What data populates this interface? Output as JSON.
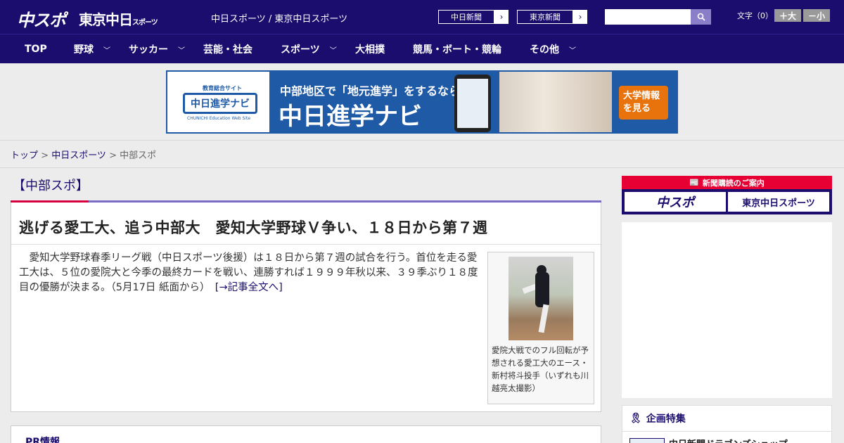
{
  "header": {
    "logo_chuspo": "中スポ",
    "logo_tokyo": "東京中日",
    "logo_tokyo_small": "スポーツ",
    "site_links": "中日スポーツ / 東京中日スポーツ",
    "btn_chunichi": "中日新聞",
    "btn_tokyo": "東京新聞",
    "search_placeholder": "",
    "moji_label": "文字（0）",
    "size_up": "＋大",
    "size_down": "－小"
  },
  "nav": {
    "items": [
      {
        "label": "TOP",
        "has_menu": false
      },
      {
        "label": "野球",
        "has_menu": true
      },
      {
        "label": "サッカー",
        "has_menu": true
      },
      {
        "label": "芸能・社会",
        "has_menu": false
      },
      {
        "label": "スポーツ",
        "has_menu": true
      },
      {
        "label": "大相撲",
        "has_menu": false
      },
      {
        "label": "競馬・ボート・競輪",
        "has_menu": false
      },
      {
        "label": "その他",
        "has_menu": true
      }
    ]
  },
  "banner": {
    "tag": "教育総合サイト",
    "logo_text": "中日進学ナビ",
    "logo_sub": "CHUNICHI Education Web Site",
    "line1": "中部地区で「地元進学」をするなら",
    "line2": "中日進学ナビ",
    "cta_line1": "大学情報",
    "cta_line2": "を見る"
  },
  "breadcrumb": {
    "home": "トップ",
    "sep1": " > ",
    "parent": "中日スポーツ",
    "sep2": " > ",
    "current": "中部スポ"
  },
  "section": {
    "title": "【中部スポ】"
  },
  "article": {
    "headline": "逃げる愛工大、追う中部大　愛知大学野球Ｖ争い、１８日から第７週",
    "body": "　愛知大学野球春季リーグ戦（中日スポーツ後援）は１８日から第７週の試合を行う。首位を走る愛工大は、５位の愛院大と今季の最終カードを戦い、連勝すれば１９９９年秋以来、３９季ぶり１８度目の優勝が決まる。（5月17日 紙面から）　",
    "more_link": "[→記事全文へ]",
    "caption": "愛院大戦でのフル回転が予想される愛工大のエース・新村将斗投手（いずれも川越亮太撮影）"
  },
  "pr": {
    "title": "PR情報"
  },
  "sidebar": {
    "subscription_head": "新聞購読のご案内",
    "sub_logo1": "中スポ",
    "sub_logo2": "東京中日スポーツ",
    "feature_title": "企画特集",
    "feature_item": "中日新聞ドラゴンズショップ"
  },
  "colors": {
    "brand_navy": "#1a0d6e",
    "accent_red": "#d9003f",
    "link": "#1a0d6e"
  }
}
